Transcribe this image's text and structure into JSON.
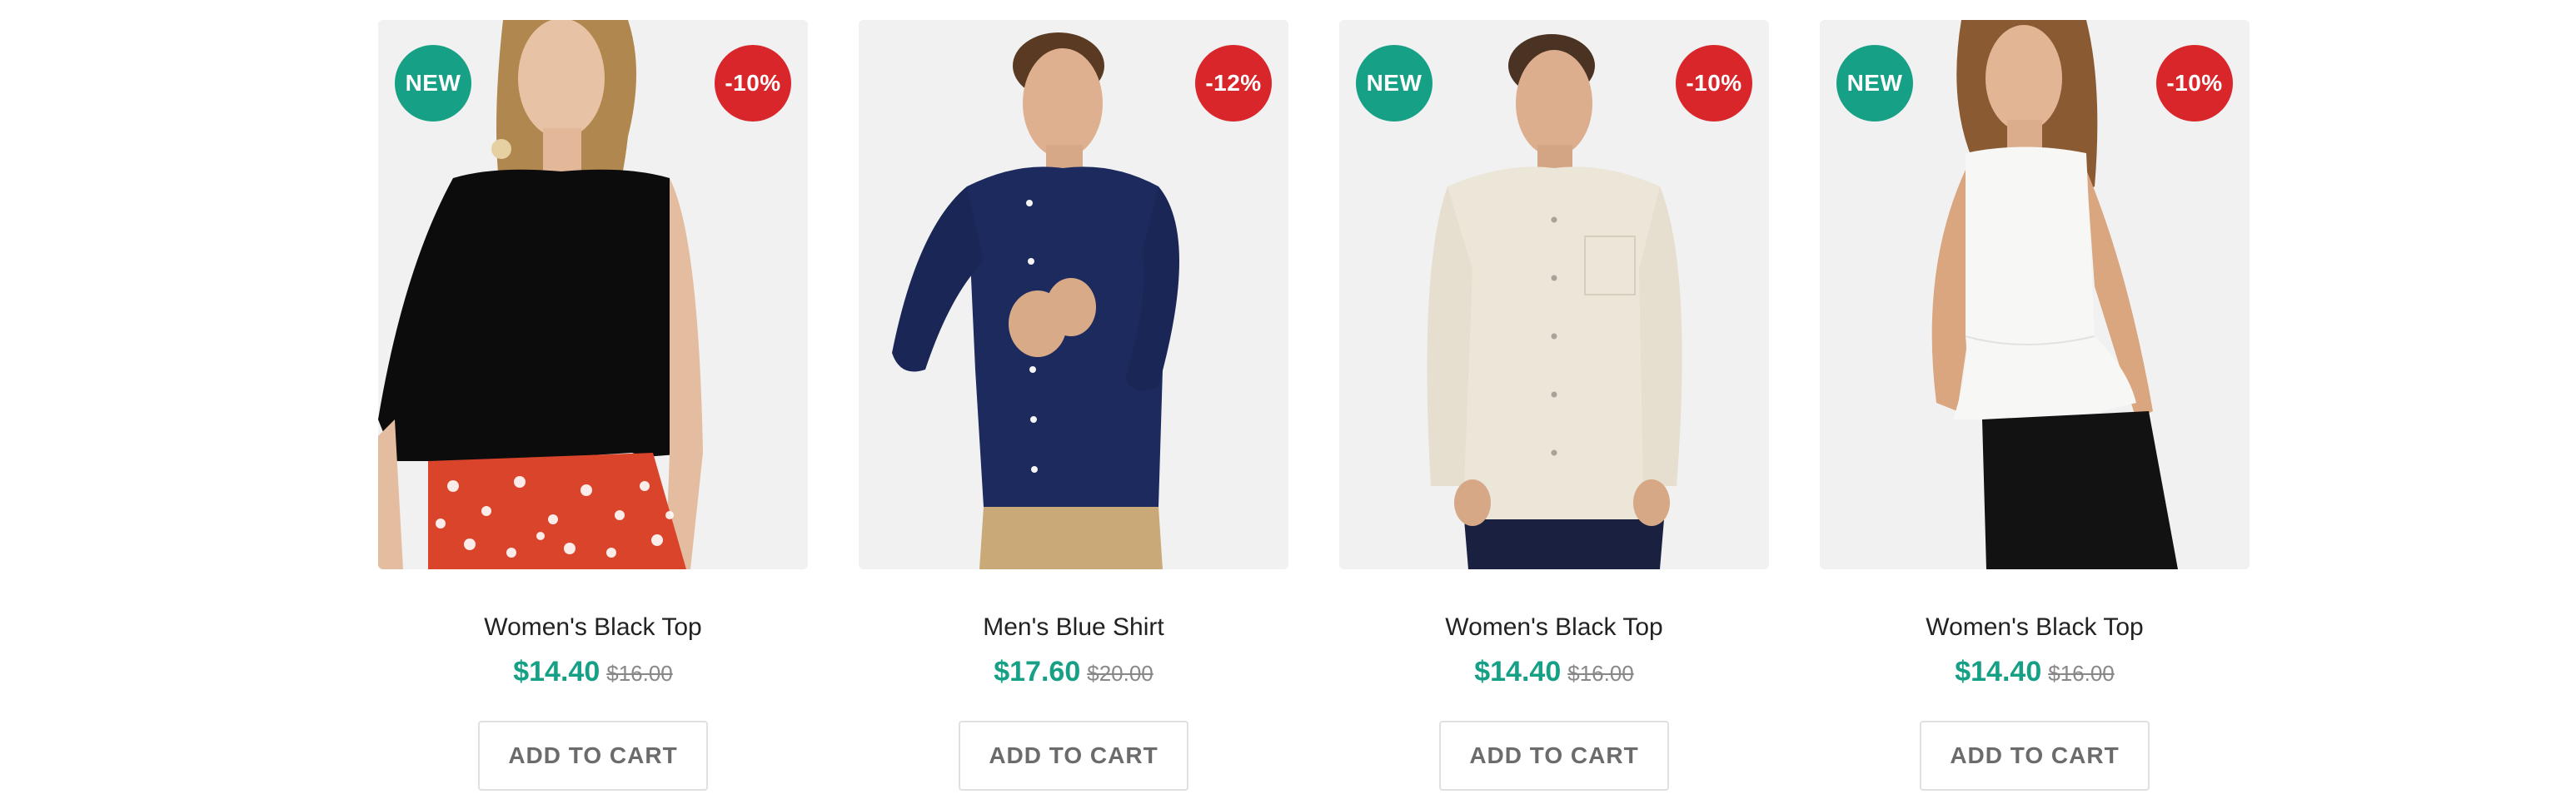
{
  "products": [
    {
      "badge_new": "NEW",
      "badge_discount": "-10%",
      "title": "Women's Black Top",
      "price": "$14.40",
      "old_price": "$16.00",
      "button": "ADD TO CART",
      "image": "woman-black-top-red-floral-skirt"
    },
    {
      "badge_new": "",
      "badge_discount": "-12%",
      "title": "Men's Blue Shirt",
      "price": "$17.60",
      "old_price": "$20.00",
      "button": "ADD TO CART",
      "image": "man-navy-shirt-khaki-pants"
    },
    {
      "badge_new": "NEW",
      "badge_discount": "-10%",
      "title": "Women's Black Top",
      "price": "$14.40",
      "old_price": "$16.00",
      "button": "ADD TO CART",
      "image": "man-beige-linen-shirt"
    },
    {
      "badge_new": "NEW",
      "badge_discount": "-10%",
      "title": "Women's Black Top",
      "price": "$14.40",
      "old_price": "$16.00",
      "button": "ADD TO CART",
      "image": "woman-white-peplum-top-black-pants"
    }
  ],
  "colors": {
    "accent": "#16a085",
    "sale": "#d9262b",
    "photo_bg": "#f1f1f2"
  }
}
